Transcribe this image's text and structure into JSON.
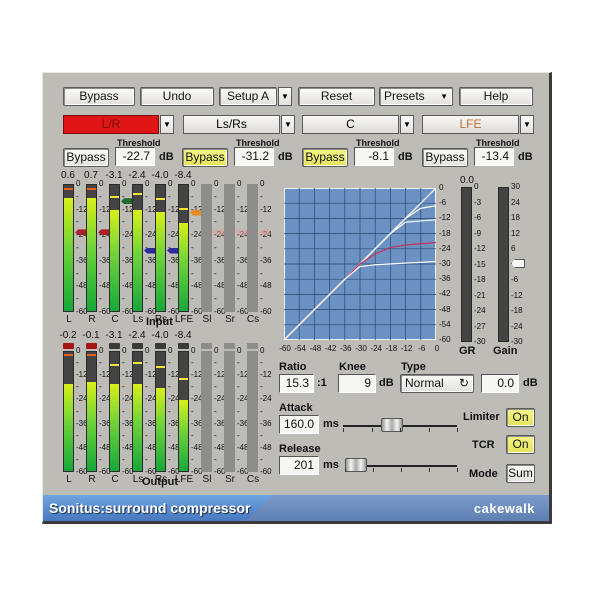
{
  "app": {
    "title": "Sonitus:surround compressor",
    "brand": "cakewalk"
  },
  "toolbar": {
    "bypass": "Bypass",
    "undo": "Undo",
    "setup": "Setup A",
    "reset": "Reset",
    "presets": "Presets",
    "help": "Help"
  },
  "channels": [
    {
      "name": "L/R",
      "bypass": "Bypass",
      "bypass_active": false,
      "threshold_label": "Threshold",
      "threshold": "-22.7",
      "unit": "dB"
    },
    {
      "name": "Ls/Rs",
      "bypass": "Bypass",
      "bypass_active": true,
      "threshold_label": "Threshold",
      "threshold": "-31.2",
      "unit": "dB"
    },
    {
      "name": "C",
      "bypass": "Bypass",
      "bypass_active": true,
      "threshold_label": "Threshold",
      "threshold": "-8.1",
      "unit": "dB"
    },
    {
      "name": "LFE",
      "bypass": "Bypass",
      "bypass_active": false,
      "threshold_label": "Threshold",
      "threshold": "-13.4",
      "unit": "dB"
    }
  ],
  "input_meters": {
    "label": "Input",
    "channels": [
      {
        "name": "L",
        "peak": "0.6",
        "level_db": -6,
        "peak_hold_db": -1.5,
        "active": true,
        "threshold_db": -22.7
      },
      {
        "name": "R",
        "peak": "0.7",
        "level_db": -6,
        "peak_hold_db": -1.5,
        "active": true,
        "threshold_db": -22.7
      },
      {
        "name": "C",
        "peak": "-3.1",
        "level_db": -12,
        "peak_hold_db": -5,
        "active": true,
        "threshold_db": -8.1
      },
      {
        "name": "Ls",
        "peak": "-2.4",
        "level_db": -12,
        "peak_hold_db": -4,
        "active": true,
        "threshold_db": -31.2
      },
      {
        "name": "Rs",
        "peak": "-4.0",
        "level_db": -13,
        "peak_hold_db": -6,
        "active": true,
        "threshold_db": -31.2
      },
      {
        "name": "LFE",
        "peak": "-8.4",
        "level_db": -18,
        "peak_hold_db": -11,
        "active": true,
        "threshold_db": -13.4
      },
      {
        "name": "Sl",
        "peak": "",
        "level_db": null,
        "peak_hold_db": null,
        "active": false,
        "threshold_db": -22.7
      },
      {
        "name": "Sr",
        "peak": "",
        "level_db": null,
        "peak_hold_db": null,
        "active": false,
        "threshold_db": -22.7
      },
      {
        "name": "Cs",
        "peak": "",
        "level_db": null,
        "peak_hold_db": null,
        "active": false,
        "threshold_db": -22.7
      }
    ],
    "scale": [
      "0",
      "-",
      "-12",
      "-",
      "-24",
      "-",
      "-36",
      "-",
      "-48",
      "-",
      "-60"
    ]
  },
  "output_meters": {
    "label": "Output",
    "channels": [
      {
        "name": "L",
        "peak": "-0.2",
        "level_db": -16,
        "peak_hold_db": -1,
        "active": true,
        "clip": true
      },
      {
        "name": "R",
        "peak": "-0.1",
        "level_db": -15,
        "peak_hold_db": -1,
        "active": true,
        "clip": true
      },
      {
        "name": "C",
        "peak": "-3.1",
        "level_db": -16,
        "peak_hold_db": -6,
        "active": true,
        "clip": false
      },
      {
        "name": "Ls",
        "peak": "-2.4",
        "level_db": -16,
        "peak_hold_db": -5,
        "active": true,
        "clip": false
      },
      {
        "name": "Rs",
        "peak": "-4.0",
        "level_db": -18,
        "peak_hold_db": -7,
        "active": true,
        "clip": false
      },
      {
        "name": "LFE",
        "peak": "-8.4",
        "level_db": -24,
        "peak_hold_db": -13,
        "active": true,
        "clip": false
      },
      {
        "name": "Sl",
        "peak": "",
        "level_db": null,
        "peak_hold_db": null,
        "active": false,
        "clip": false
      },
      {
        "name": "Sr",
        "peak": "",
        "level_db": null,
        "peak_hold_db": null,
        "active": false,
        "clip": false
      },
      {
        "name": "Cs",
        "peak": "",
        "level_db": null,
        "peak_hold_db": null,
        "active": false,
        "clip": false
      }
    ],
    "scale": [
      "0",
      "-",
      "-12",
      "-",
      "-24",
      "-",
      "-36",
      "-",
      "-48",
      "-",
      "-60"
    ]
  },
  "transfer_graph": {
    "x_ticks": [
      "-60",
      "-54",
      "-48",
      "-42",
      "-36",
      "-30",
      "-24",
      "-18",
      "-12",
      "-6",
      "0"
    ],
    "y_ticks": [
      "0",
      "-6",
      "-12",
      "-18",
      "-24",
      "-30",
      "-36",
      "-42",
      "-48",
      "-54",
      "-60"
    ],
    "range_db": [
      -60,
      0
    ],
    "curves": [
      {
        "name": "unity",
        "color": "#ffffff",
        "points": [
          [
            -60,
            -60
          ],
          [
            0,
            0
          ]
        ]
      },
      {
        "name": "C",
        "color": "#ffffff",
        "points": [
          [
            -60,
            -60
          ],
          [
            -12,
            -12
          ],
          [
            -6,
            -8
          ],
          [
            0,
            -7
          ]
        ]
      },
      {
        "name": "LFE",
        "color": "#ffffff",
        "points": [
          [
            -60,
            -60
          ],
          [
            -18,
            -18
          ],
          [
            -12,
            -13.5
          ],
          [
            0,
            -12.5
          ]
        ]
      },
      {
        "name": "L/R",
        "color": "#c8345a",
        "points": [
          [
            -60,
            -60
          ],
          [
            -30,
            -30
          ],
          [
            -24,
            -26
          ],
          [
            -18,
            -23.5
          ],
          [
            -12,
            -22.5
          ],
          [
            0,
            -21.5
          ]
        ]
      },
      {
        "name": "Ls/Rs",
        "color": "#ffffff",
        "points": [
          [
            -60,
            -60
          ],
          [
            -36,
            -36
          ],
          [
            -30,
            -31
          ],
          [
            -24,
            -30.3
          ],
          [
            0,
            -29
          ]
        ]
      }
    ]
  },
  "gr_meter": {
    "label": "GR",
    "value": "0.0",
    "scale": [
      "0",
      "-3",
      "-6",
      "-9",
      "-12",
      "-15",
      "-18",
      "-21",
      "-24",
      "-27",
      "-30"
    ]
  },
  "gain_meter": {
    "label": "Gain",
    "value_db": 0,
    "range_db": [
      -30,
      30
    ],
    "scale": [
      "30",
      "24",
      "18",
      "12",
      "6",
      "",
      "-6",
      "-12",
      "-18",
      "-24",
      "-30"
    ]
  },
  "controls": {
    "ratio_label": "Ratio",
    "ratio": "15.3",
    "ratio_unit": ":1",
    "knee_label": "Knee",
    "knee": "9",
    "knee_unit": "dB",
    "type_label": "Type",
    "type": "Normal",
    "gain_value": "0.0",
    "gain_unit": "dB",
    "attack_label": "Attack",
    "attack": "160.0",
    "attack_unit": "ms",
    "attack_slider": 0.43,
    "release_label": "Release",
    "release": "201",
    "release_unit": "ms",
    "release_slider": 0.1,
    "limiter_label": "Limiter",
    "limiter": "On",
    "tcr_label": "TCR",
    "tcr": "On",
    "mode_label": "Mode",
    "mode": "Sum"
  }
}
